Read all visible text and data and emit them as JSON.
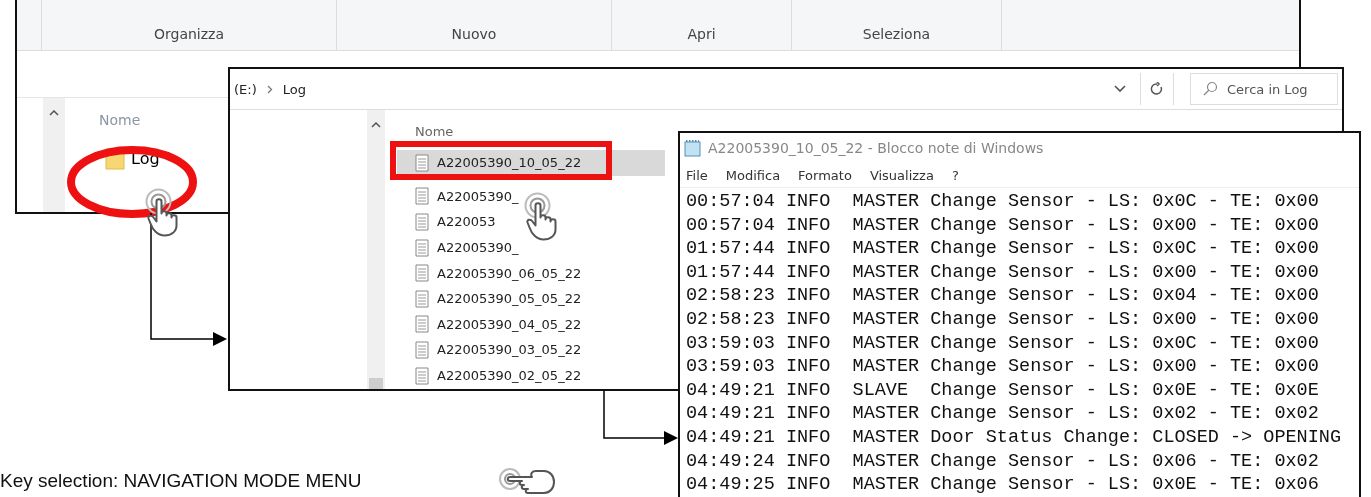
{
  "explorer_back": {
    "ribbon_groups": [
      "Organizza",
      "Nuovo",
      "Apri",
      "Seleziona"
    ],
    "column_header": "Nome",
    "folder": {
      "name": "Log",
      "selected": true
    }
  },
  "explorer_front": {
    "path": [
      "(E:)",
      "Log"
    ],
    "search": {
      "placeholder": "Cerca in Log"
    },
    "column_header": "Nome",
    "files": [
      {
        "name": "A22005390_10_05_22",
        "selected": true
      },
      {
        "name": "A22005390_",
        "selected": false
      },
      {
        "name": "A220053",
        "selected": false
      },
      {
        "name": "A22005390_",
        "selected": false
      },
      {
        "name": "A22005390_06_05_22",
        "selected": false
      },
      {
        "name": "A22005390_05_05_22",
        "selected": false
      },
      {
        "name": "A22005390_04_05_22",
        "selected": false
      },
      {
        "name": "A22005390_03_05_22",
        "selected": false
      },
      {
        "name": "A22005390_02_05_22",
        "selected": false
      }
    ]
  },
  "notepad": {
    "title": "A22005390_10_05_22 - Blocco note di Windows",
    "menu": [
      "File",
      "Modifica",
      "Formato",
      "Visualizza",
      "?"
    ],
    "lines": [
      "00:57:04 INFO  MASTER Change Sensor - LS: 0x0C - TE: 0x00",
      "00:57:04 INFO  MASTER Change Sensor - LS: 0x00 - TE: 0x00",
      "01:57:44 INFO  MASTER Change Sensor - LS: 0x0C - TE: 0x00",
      "01:57:44 INFO  MASTER Change Sensor - LS: 0x00 - TE: 0x00",
      "02:58:23 INFO  MASTER Change Sensor - LS: 0x04 - TE: 0x00",
      "02:58:23 INFO  MASTER Change Sensor - LS: 0x00 - TE: 0x00",
      "03:59:03 INFO  MASTER Change Sensor - LS: 0x0C - TE: 0x00",
      "03:59:03 INFO  MASTER Change Sensor - LS: 0x00 - TE: 0x00",
      "04:49:21 INFO  SLAVE  Change Sensor - LS: 0x0E - TE: 0x0E",
      "04:49:21 INFO  MASTER Change Sensor - LS: 0x02 - TE: 0x02",
      "04:49:21 INFO  MASTER Door Status Change: CLOSED -> OPENING",
      "04:49:24 INFO  MASTER Change Sensor - LS: 0x06 - TE: 0x02",
      "04:49:25 INFO  MASTER Change Sensor - LS: 0x0E - TE: 0x06"
    ]
  },
  "caption": "Key selection: NAVIGATION MODE MENU"
}
